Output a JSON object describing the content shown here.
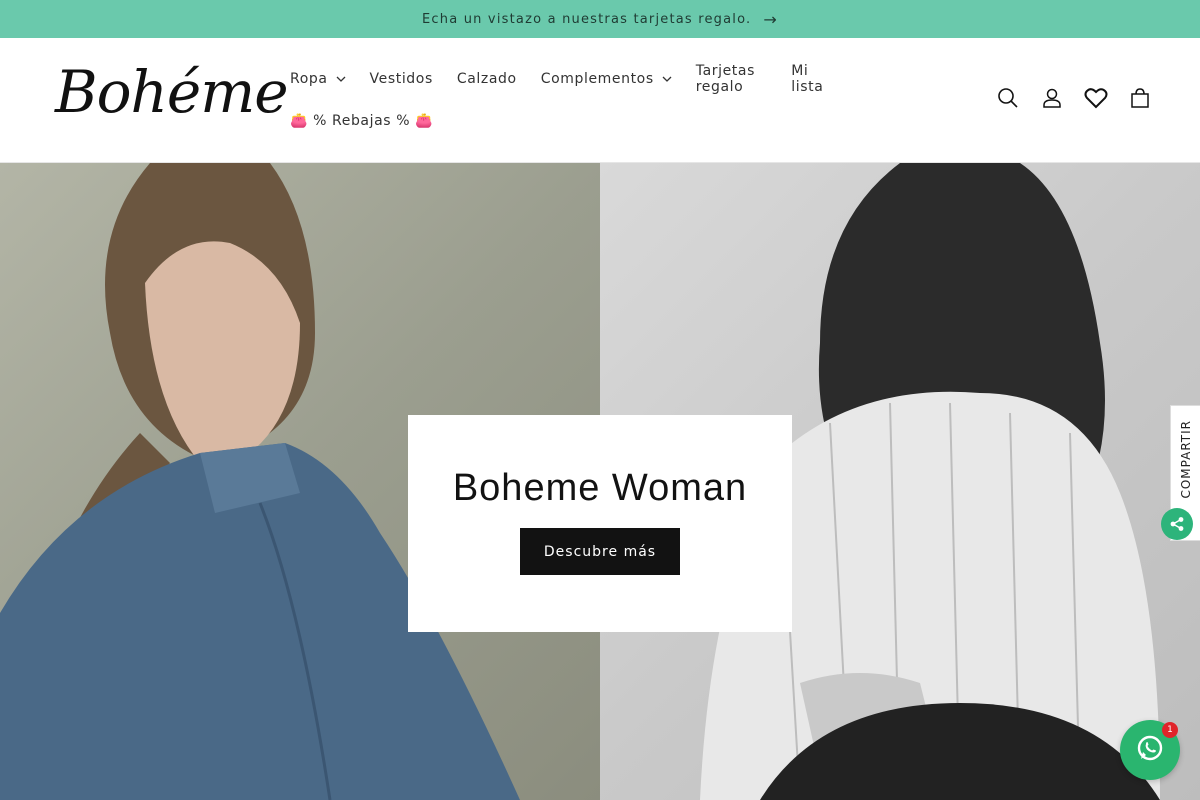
{
  "announcement": {
    "text": "Echa un vistazo a nuestras tarjetas regalo.",
    "arrow": "→"
  },
  "header": {
    "logo": "Bohéme",
    "nav": [
      {
        "label": "Ropa",
        "has_dropdown": true
      },
      {
        "label": "Vestidos",
        "has_dropdown": false
      },
      {
        "label": "Calzado",
        "has_dropdown": false
      },
      {
        "label": "Complementos",
        "has_dropdown": true
      },
      {
        "label": "Tarjetas regalo",
        "has_dropdown": false
      },
      {
        "label": "Mi lista",
        "has_dropdown": false
      },
      {
        "label": "👛 % Rebajas % 👛",
        "has_dropdown": false
      }
    ],
    "icons": [
      "search-icon",
      "account-icon",
      "wishlist-heart-icon",
      "cart-icon"
    ]
  },
  "hero": {
    "title": "Boheme Woman",
    "button_label": "Descubre más"
  },
  "share": {
    "label": "COMPARTIR"
  },
  "whatsapp": {
    "badge_count": "1"
  },
  "colors": {
    "announcement_bg": "#6ac9ac",
    "button_bg": "#121212",
    "whatsapp_green": "#2ab56f",
    "badge_red": "#e0242a"
  }
}
